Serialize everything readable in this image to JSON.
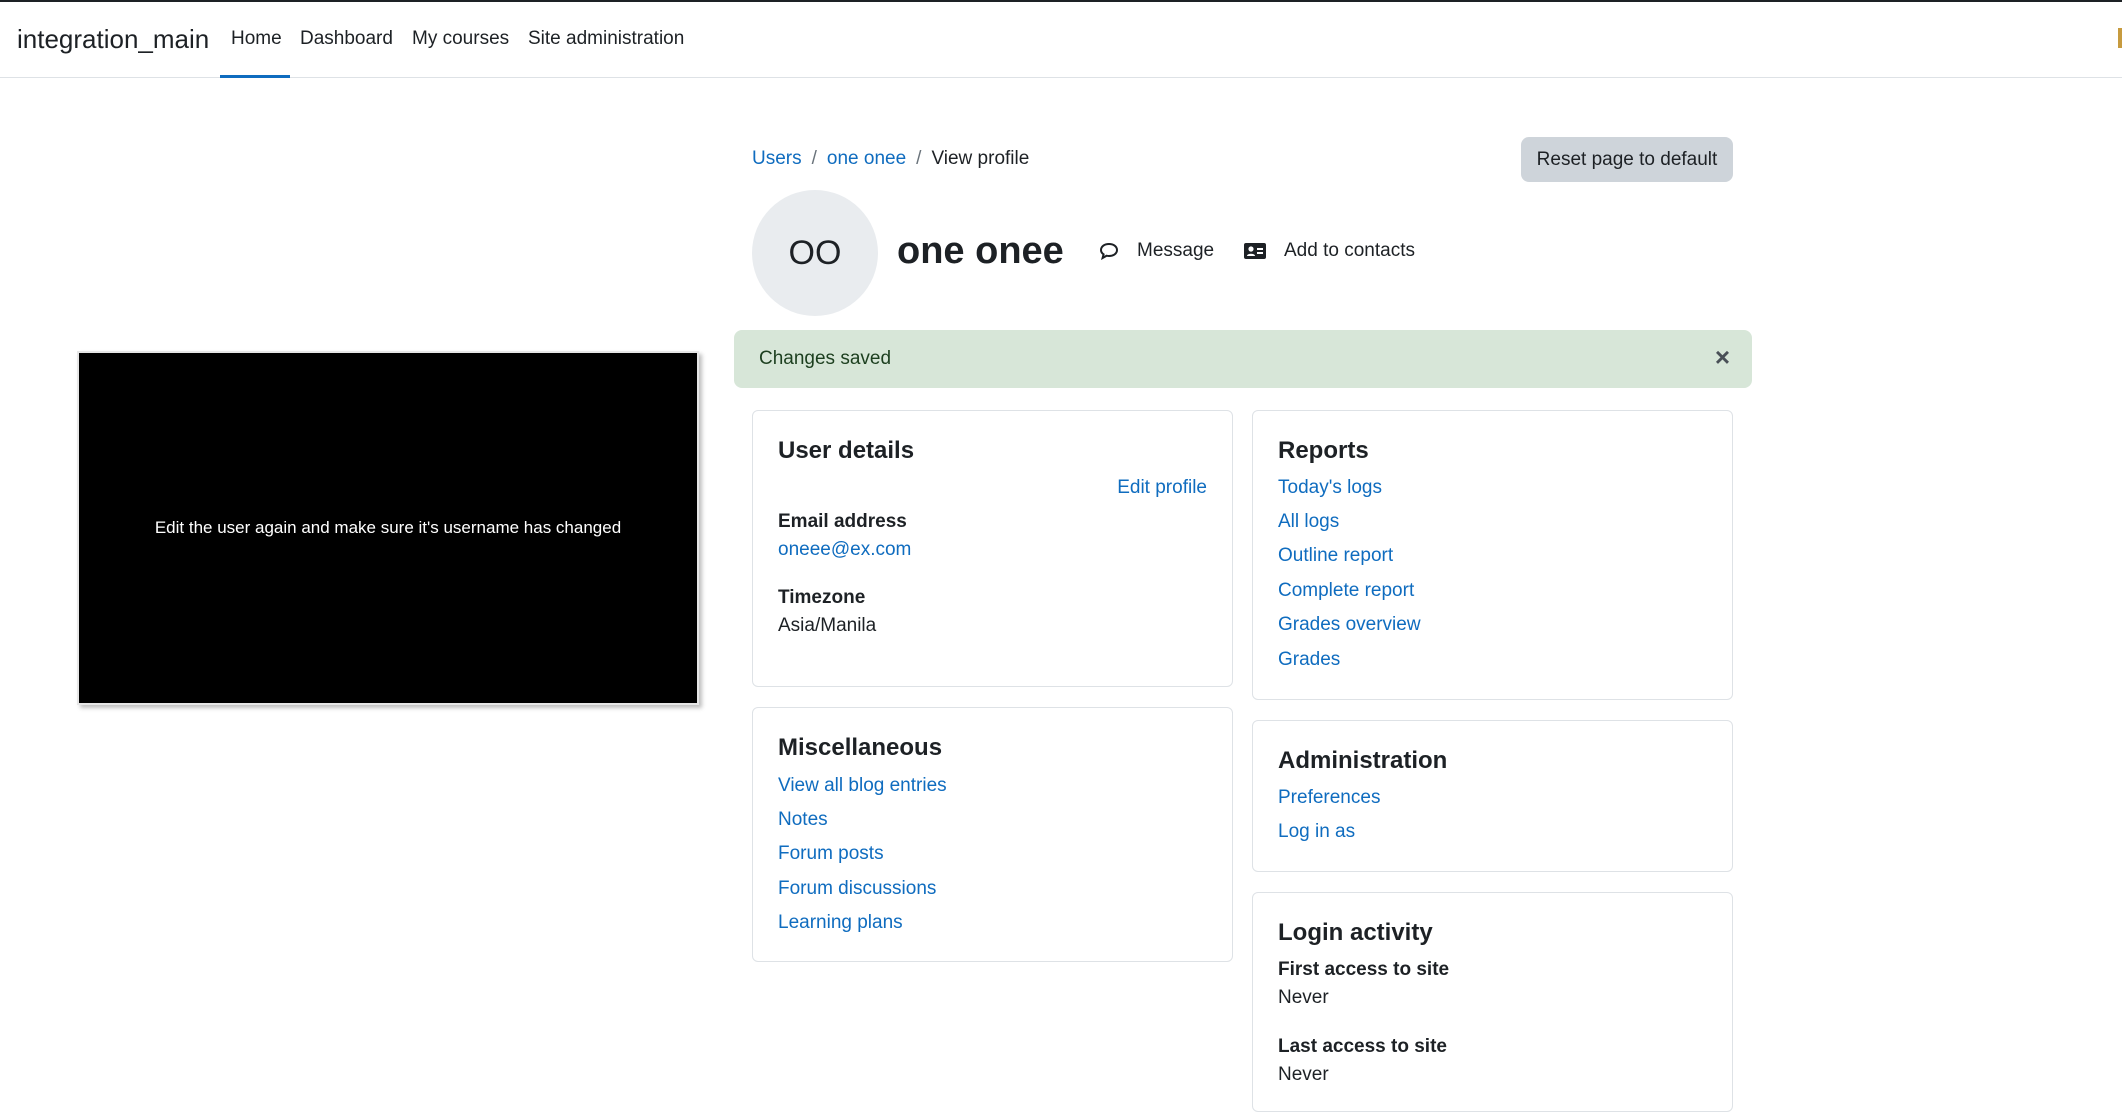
{
  "navbar": {
    "brand": "integration_main",
    "items": [
      {
        "label": "Home",
        "active": true
      },
      {
        "label": "Dashboard"
      },
      {
        "label": "My courses"
      },
      {
        "label": "Site administration"
      }
    ]
  },
  "video": {
    "caption": "Edit the user again and make sure it's username has changed"
  },
  "breadcrumb": {
    "items": [
      "Users",
      "one onee",
      "View profile"
    ],
    "separator": "/"
  },
  "reset_button": "Reset page to default",
  "profile": {
    "initials": "OO",
    "name": "one onee",
    "message_label": "Message",
    "add_contacts_label": "Add to contacts"
  },
  "alert": {
    "text": "Changes saved",
    "close": "×"
  },
  "user_details": {
    "title": "User details",
    "edit_link": "Edit profile",
    "email_label": "Email address",
    "email_value": "oneee@ex.com",
    "timezone_label": "Timezone",
    "timezone_value": "Asia/Manila"
  },
  "miscellaneous": {
    "title": "Miscellaneous",
    "links": [
      "View all blog entries",
      "Notes",
      "Forum posts",
      "Forum discussions",
      "Learning plans"
    ]
  },
  "reports": {
    "title": "Reports",
    "links": [
      "Today's logs",
      "All logs",
      "Outline report",
      "Complete report",
      "Grades overview",
      "Grades"
    ]
  },
  "administration": {
    "title": "Administration",
    "links": [
      "Preferences",
      "Log in as"
    ]
  },
  "login_activity": {
    "title": "Login activity",
    "first_label": "First access to site",
    "first_value": "Never",
    "last_label": "Last access to site",
    "last_value": "Never"
  },
  "colors": {
    "link": "#0f6cbf",
    "alert_bg": "#d7e6d8",
    "button_bg": "#ced4da"
  }
}
